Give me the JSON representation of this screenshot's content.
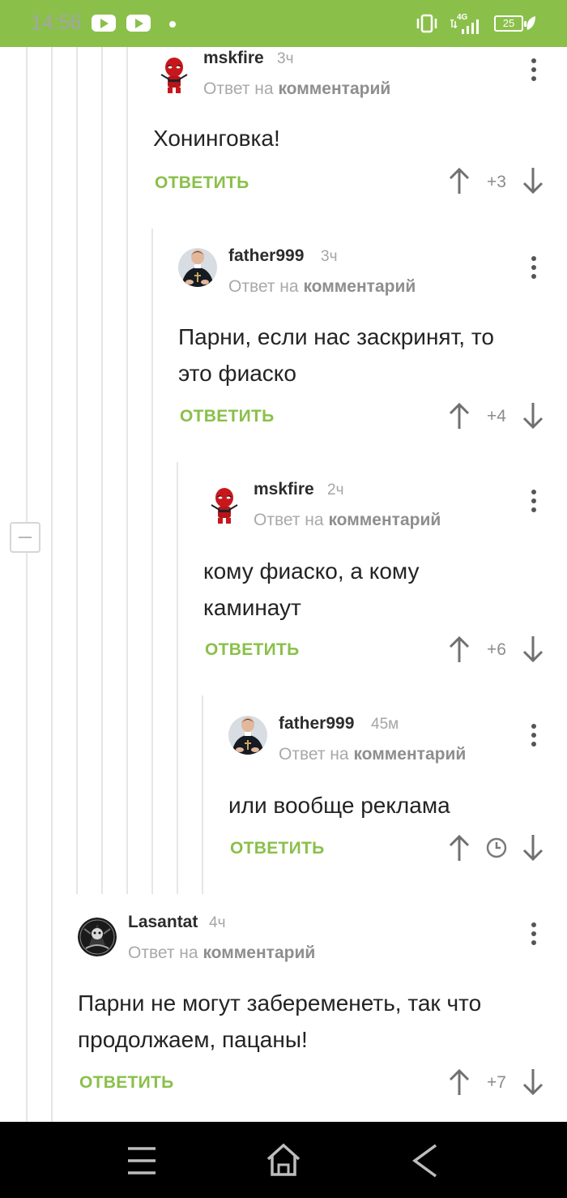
{
  "status_bar": {
    "time": "14:56",
    "network": "4G",
    "battery": "25",
    "colors": {
      "background": "#8ac04a"
    },
    "icons": [
      "youtube-icon",
      "youtube-icon",
      "notification-dot-icon",
      "vibrate-icon",
      "signal-icon",
      "battery-icon",
      "leaf-icon"
    ]
  },
  "ui": {
    "reply_prefix": "Ответ на",
    "reply_target": "комментарий",
    "reply_button": "ОТВЕТИТЬ",
    "accent_color": "#8ac04a"
  },
  "comments": [
    {
      "author": "mskfire",
      "time": "3ч",
      "text_lines": [
        "Хонинговка!"
      ],
      "rating": "+3",
      "avatar_icon": "deadpool-avatar"
    },
    {
      "author": "father999",
      "time": "3ч",
      "text_lines": [
        "Парни, если нас заскринят, то",
        "это фиаско"
      ],
      "rating": "+4",
      "avatar_icon": "priest-avatar"
    },
    {
      "author": "mskfire",
      "time": "2ч",
      "text_lines": [
        "кому фиаско, а кому",
        "каминаут"
      ],
      "rating": "+6",
      "avatar_icon": "deadpool-avatar"
    },
    {
      "author": "father999",
      "time": "45м",
      "text_lines": [
        "или вообще реклама"
      ],
      "rating": "",
      "rating_icon": "clock-icon",
      "avatar_icon": "priest-avatar"
    },
    {
      "author": "Lasantat",
      "time": "4ч",
      "text_lines": [
        "Парни не могут забеременеть, так что",
        "продолжаем, пацаны!"
      ],
      "rating": "+7",
      "avatar_icon": "dark-round-avatar"
    }
  ],
  "nav_bar": {
    "icons": [
      "menu-icon",
      "home-icon",
      "back-icon"
    ]
  }
}
